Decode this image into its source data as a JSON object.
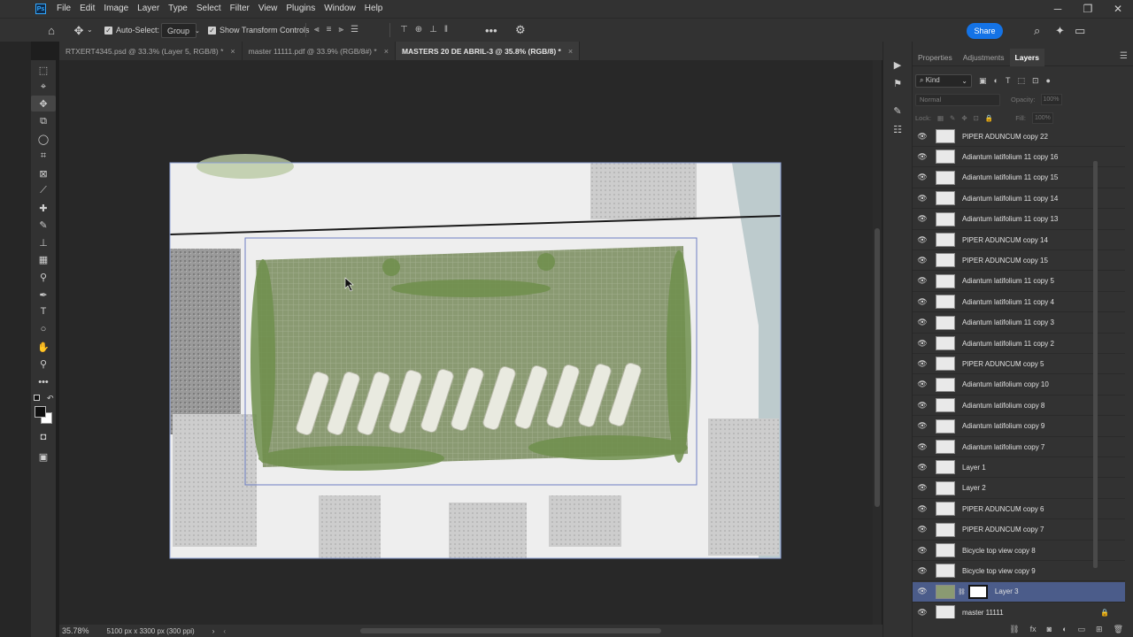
{
  "menubar": {
    "logo": "Ps",
    "items": [
      "File",
      "Edit",
      "Image",
      "Layer",
      "Type",
      "Select",
      "Filter",
      "View",
      "Plugins",
      "Window",
      "Help"
    ]
  },
  "options": {
    "auto_select_label": "Auto-Select:",
    "auto_select_checked": true,
    "group_value": "Group",
    "transform_label": "Show Transform Controls",
    "transform_checked": true,
    "share_label": "Share"
  },
  "tabs": [
    {
      "label": "RTXERT4345.psd @ 33.3% (Layer 5, RGB/8) *",
      "active": false
    },
    {
      "label": "master 11111.pdf @ 33.9% (RGB/8#) *",
      "active": false
    },
    {
      "label": "MASTERS 20 DE ABRIL-3 @ 35.8% (RGB/8) *",
      "active": true
    }
  ],
  "status": {
    "zoom": "35.78%",
    "doc_info": "5100 px x 3300 px (300 ppi)"
  },
  "layers_panel": {
    "tabs": [
      "Properties",
      "Adjustments",
      "Layers"
    ],
    "active_tab": "Layers",
    "kind_label": "Kind",
    "blend_mode": "Normal",
    "opacity_label": "Opacity:",
    "opacity_value": "100%",
    "lock_label": "Lock:",
    "fill_label": "Fill:",
    "fill_value": "100%",
    "layers": [
      {
        "name": "PIPER ADUNCUM copy 22",
        "selected": false
      },
      {
        "name": "Adiantum latifolium 11 copy 16",
        "selected": false
      },
      {
        "name": "Adiantum latifolium 11 copy 15",
        "selected": false
      },
      {
        "name": "Adiantum latifolium 11 copy 14",
        "selected": false
      },
      {
        "name": "Adiantum latifolium 11 copy 13",
        "selected": false
      },
      {
        "name": "PIPER ADUNCUM copy 14",
        "selected": false
      },
      {
        "name": "PIPER ADUNCUM copy 15",
        "selected": false
      },
      {
        "name": "Adiantum latifolium 11 copy 5",
        "selected": false
      },
      {
        "name": "Adiantum latifolium 11 copy 4",
        "selected": false
      },
      {
        "name": "Adiantum latifolium 11 copy 3",
        "selected": false
      },
      {
        "name": "Adiantum latifolium 11 copy 2",
        "selected": false
      },
      {
        "name": "PIPER ADUNCUM copy 5",
        "selected": false
      },
      {
        "name": "Adiantum latifolium copy 10",
        "selected": false
      },
      {
        "name": "Adiantum latifolium copy 8",
        "selected": false
      },
      {
        "name": "Adiantum latifolium copy 9",
        "selected": false
      },
      {
        "name": "Adiantum latifolium copy 7",
        "selected": false
      },
      {
        "name": "Layer 1",
        "selected": false
      },
      {
        "name": "Layer 2",
        "selected": false
      },
      {
        "name": "PIPER ADUNCUM copy 6",
        "selected": false
      },
      {
        "name": "PIPER ADUNCUM copy 7",
        "selected": false
      },
      {
        "name": "Bicycle top view copy 8",
        "selected": false
      },
      {
        "name": "Bicycle top view copy 9",
        "selected": false
      },
      {
        "name": "Layer 3",
        "selected": true,
        "has_mask": true
      },
      {
        "name": "master 11111",
        "selected": false,
        "locked": true
      }
    ]
  },
  "colors": {
    "app_bg": "#323232",
    "canvas_bg": "#282828",
    "accent_blue": "#1473e6",
    "selected_layer": "#4b5c8a",
    "grass": "#8a9a72"
  }
}
